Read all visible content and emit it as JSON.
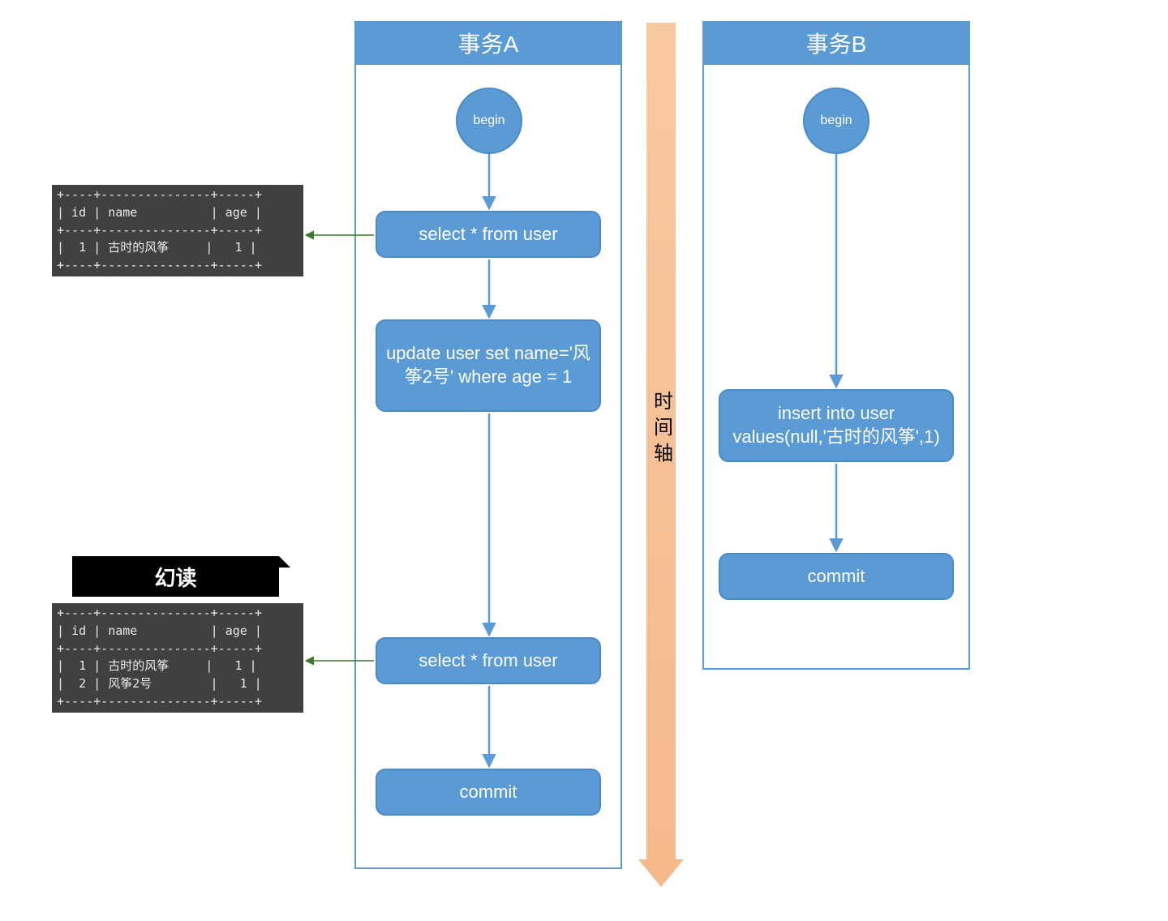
{
  "transactionA": {
    "title": "事务A",
    "begin": "begin",
    "steps": [
      "select * from user",
      "update user set name='风筝2号' where age = 1",
      "select * from user",
      "commit"
    ]
  },
  "transactionB": {
    "title": "事务B",
    "begin": "begin",
    "steps": [
      "insert into user values(null,'古时的风筝',1)",
      "commit"
    ]
  },
  "timeline": {
    "label": "时间轴"
  },
  "phantomRead": {
    "title": "幻读"
  },
  "result1": {
    "header": "+----+---------------+-----+\n| id | name          | age |\n+----+---------------+-----+\n|  1 | 古时的风筝     |   1 |\n+----+---------------+-----+"
  },
  "result2": {
    "header": "+----+---------------+-----+\n| id | name          | age |\n+----+---------------+-----+\n|  1 | 古时的风筝     |   1 |\n|  2 | 风筝2号        |   1 |\n+----+---------------+-----+"
  },
  "colors": {
    "blue": "#5b9bd5",
    "terminal": "#404041",
    "timeArrow": "#f5b98c"
  },
  "chart_data": {
    "type": "diagram",
    "title": "幻读 (Phantom Read) — transaction timeline",
    "timeline_direction": "top-to-bottom",
    "lanes": [
      {
        "name": "事务A",
        "events": [
          {
            "order": 1,
            "kind": "begin",
            "label": "begin"
          },
          {
            "order": 2,
            "kind": "sql",
            "label": "select * from user",
            "result": {
              "columns": [
                "id",
                "name",
                "age"
              ],
              "rows": [
                [
                  1,
                  "古时的风筝",
                  1
                ]
              ]
            }
          },
          {
            "order": 3,
            "kind": "sql",
            "label": "update user set name='风筝2号' where age = 1"
          },
          {
            "order": 6,
            "kind": "sql",
            "label": "select * from user",
            "result": {
              "columns": [
                "id",
                "name",
                "age"
              ],
              "rows": [
                [
                  1,
                  "古时的风筝",
                  1
                ],
                [
                  2,
                  "风筝2号",
                  1
                ]
              ]
            },
            "annotation": "幻读"
          },
          {
            "order": 7,
            "kind": "commit",
            "label": "commit"
          }
        ]
      },
      {
        "name": "事务B",
        "events": [
          {
            "order": 1,
            "kind": "begin",
            "label": "begin"
          },
          {
            "order": 4,
            "kind": "sql",
            "label": "insert into user values(null,'古时的风筝',1)"
          },
          {
            "order": 5,
            "kind": "commit",
            "label": "commit"
          }
        ]
      }
    ]
  }
}
